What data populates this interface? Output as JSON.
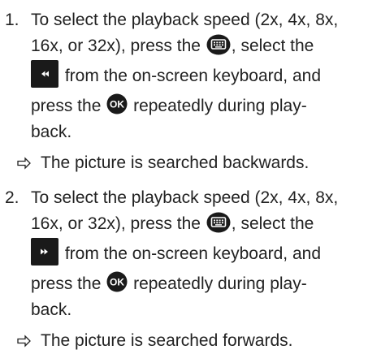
{
  "steps": [
    {
      "number": "1.",
      "line1": "To select the playback speed (2x, 4x, 8x,",
      "line2_a": "16x, or 32x), press the",
      "line2_b": ", select the",
      "line3": "from the on-screen keyboard, and",
      "line4_a": "press the",
      "line4_b": "repeatedly during play-",
      "line5": "back.",
      "key_icon": "rewind-key-icon"
    },
    {
      "number": "2.",
      "line1": "To select the playback speed (2x, 4x, 8x,",
      "line2_a": "16x, or 32x), press the",
      "line2_b": ", select the",
      "line3": "from the on-screen keyboard, and",
      "line4_a": "press the",
      "line4_b": "repeatedly during play-",
      "line5": "back.",
      "key_icon": "fast-forward-key-icon"
    }
  ],
  "results": [
    "The picture is searched backwards.",
    "The picture is searched forwards."
  ],
  "icons": {
    "keyboard_button": "keyboard-button-icon",
    "ok_button": "ok-button-icon",
    "result_arrow": "result-arrow-icon"
  },
  "colors": {
    "text": "#222222",
    "icon_fill": "#1a1a1a"
  }
}
